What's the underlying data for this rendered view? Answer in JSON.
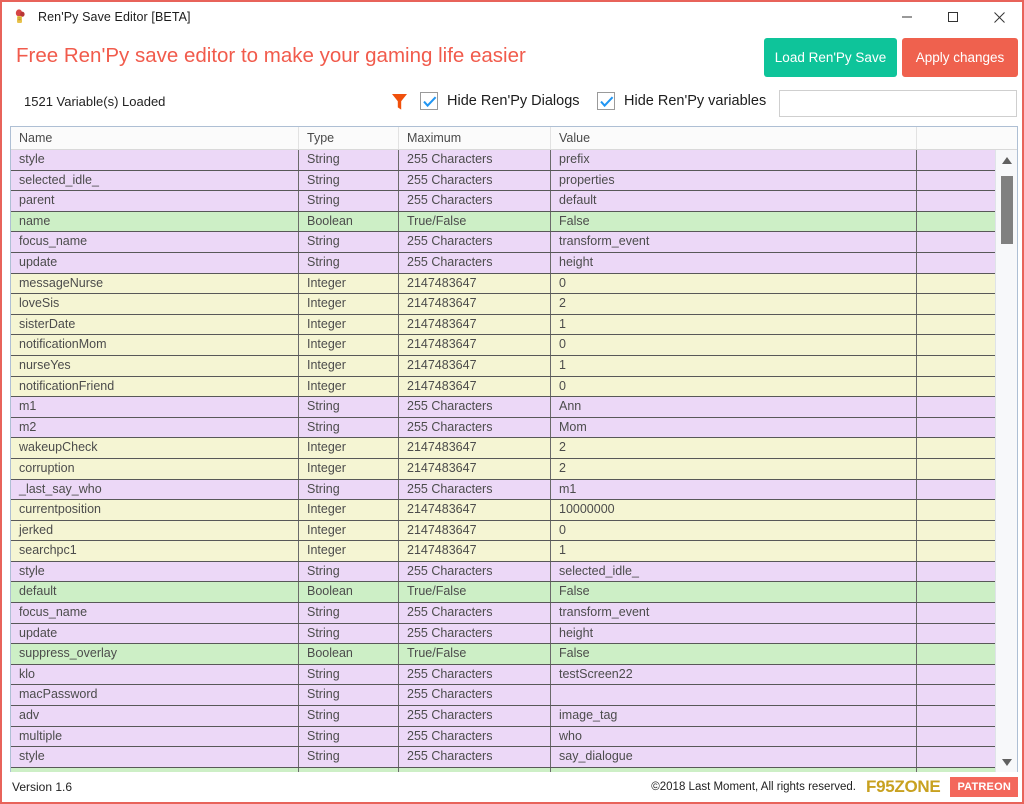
{
  "window": {
    "title": "Ren'Py Save Editor [BETA]",
    "icon": "app-icon",
    "minimize": "minimize-icon",
    "maximize": "maximize-icon",
    "close": "close-icon",
    "border_color": "#e8635a"
  },
  "header": {
    "headline": "Free Ren'Py save editor to make your gaming life easier",
    "headline_color": "#f15b4c",
    "load_button": "Load Ren'Py Save",
    "load_button_color": "#0ec49a",
    "apply_button": "Apply changes",
    "apply_button_color": "#ef614e"
  },
  "toolbar": {
    "variables_loaded": "1521 Variable(s) Loaded",
    "filter_icon": "filter-icon",
    "filter_icon_color": "#f0500c",
    "hide_dialogs_label": "Hide Ren'Py Dialogs",
    "hide_dialogs_checked": true,
    "hide_variables_label": "Hide Ren'Py variables",
    "hide_variables_checked": true,
    "search_value": "",
    "search_placeholder": ""
  },
  "grid": {
    "columns": [
      "Name",
      "Type",
      "Maximum",
      "Value",
      ""
    ],
    "row_colors": {
      "purple": "#ecd8f7",
      "green": "#cdefc6",
      "yellow": "#f5f5d3"
    },
    "rows": [
      {
        "name": "style",
        "type": "String",
        "maximum": "255 Characters",
        "value": "prefix",
        "extra": "",
        "color": "purple"
      },
      {
        "name": "selected_idle_",
        "type": "String",
        "maximum": "255 Characters",
        "value": "properties",
        "extra": "",
        "color": "purple"
      },
      {
        "name": "parent",
        "type": "String",
        "maximum": "255 Characters",
        "value": "default",
        "extra": "",
        "color": "purple"
      },
      {
        "name": "name",
        "type": "Boolean",
        "maximum": "True/False",
        "value": "False",
        "extra": "",
        "color": "green"
      },
      {
        "name": "focus_name",
        "type": "String",
        "maximum": "255 Characters",
        "value": "transform_event",
        "extra": "",
        "color": "purple"
      },
      {
        "name": "update",
        "type": "String",
        "maximum": "255 Characters",
        "value": "height",
        "extra": "",
        "color": "purple"
      },
      {
        "name": "messageNurse",
        "type": "Integer",
        "maximum": "2147483647",
        "value": "0",
        "extra": "",
        "color": "yellow"
      },
      {
        "name": "loveSis",
        "type": "Integer",
        "maximum": "2147483647",
        "value": "2",
        "extra": "",
        "color": "yellow"
      },
      {
        "name": "sisterDate",
        "type": "Integer",
        "maximum": "2147483647",
        "value": "1",
        "extra": "",
        "color": "yellow"
      },
      {
        "name": "notificationMom",
        "type": "Integer",
        "maximum": "2147483647",
        "value": "0",
        "extra": "",
        "color": "yellow"
      },
      {
        "name": "nurseYes",
        "type": "Integer",
        "maximum": "2147483647",
        "value": "1",
        "extra": "",
        "color": "yellow"
      },
      {
        "name": "notificationFriend",
        "type": "Integer",
        "maximum": "2147483647",
        "value": "0",
        "extra": "",
        "color": "yellow"
      },
      {
        "name": "m1",
        "type": "String",
        "maximum": "255 Characters",
        "value": "Ann",
        "extra": "",
        "color": "purple"
      },
      {
        "name": "m2",
        "type": "String",
        "maximum": "255 Characters",
        "value": "Mom",
        "extra": "",
        "color": "purple"
      },
      {
        "name": "wakeupCheck",
        "type": "Integer",
        "maximum": "2147483647",
        "value": "2",
        "extra": "",
        "color": "yellow"
      },
      {
        "name": "corruption",
        "type": "Integer",
        "maximum": "2147483647",
        "value": "2",
        "extra": "",
        "color": "yellow"
      },
      {
        "name": "_last_say_who",
        "type": "String",
        "maximum": "255 Characters",
        "value": "m1",
        "extra": "",
        "color": "purple"
      },
      {
        "name": "currentposition",
        "type": "Integer",
        "maximum": "2147483647",
        "value": "10000000",
        "extra": "",
        "color": "yellow"
      },
      {
        "name": "jerked",
        "type": "Integer",
        "maximum": "2147483647",
        "value": "0",
        "extra": "",
        "color": "yellow"
      },
      {
        "name": "searchpc1",
        "type": "Integer",
        "maximum": "2147483647",
        "value": "1",
        "extra": "",
        "color": "yellow"
      },
      {
        "name": "style",
        "type": "String",
        "maximum": "255 Characters",
        "value": "selected_idle_",
        "extra": "",
        "color": "purple"
      },
      {
        "name": "default",
        "type": "Boolean",
        "maximum": "True/False",
        "value": "False",
        "extra": "",
        "color": "green"
      },
      {
        "name": "focus_name",
        "type": "String",
        "maximum": "255 Characters",
        "value": "transform_event",
        "extra": "",
        "color": "purple"
      },
      {
        "name": "update",
        "type": "String",
        "maximum": "255 Characters",
        "value": "height",
        "extra": "",
        "color": "purple"
      },
      {
        "name": "suppress_overlay",
        "type": "Boolean",
        "maximum": "True/False",
        "value": "False",
        "extra": "",
        "color": "green"
      },
      {
        "name": "klo",
        "type": "String",
        "maximum": "255 Characters",
        "value": "testScreen22",
        "extra": "",
        "color": "purple"
      },
      {
        "name": "macPassword",
        "type": "String",
        "maximum": "255 Characters",
        "value": "",
        "extra": "",
        "color": "purple"
      },
      {
        "name": "adv",
        "type": "String",
        "maximum": "255 Characters",
        "value": "image_tag",
        "extra": "",
        "color": "purple"
      },
      {
        "name": "multiple",
        "type": "String",
        "maximum": "255 Characters",
        "value": "who",
        "extra": "",
        "color": "purple"
      },
      {
        "name": "style",
        "type": "String",
        "maximum": "255 Characters",
        "value": "say_dialogue",
        "extra": "",
        "color": "purple"
      },
      {
        "name": "",
        "type": "",
        "maximum": "",
        "value": "",
        "extra": "",
        "color": "green"
      }
    ],
    "scrollbar": {
      "up_icon": "scroll-up-icon",
      "down_icon": "scroll-down-icon",
      "thumb": "scroll-thumb"
    }
  },
  "footer": {
    "version": "Version 1.6",
    "copyright": "©2018 Last Moment, All rights reserved.",
    "f95zone": "F95ZONE",
    "patreon": "PATREON"
  }
}
